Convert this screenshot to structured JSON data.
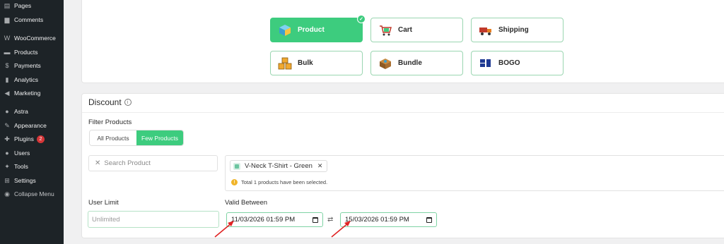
{
  "sidebar": {
    "items": [
      {
        "label": "Pages",
        "icon": "pages-icon"
      },
      {
        "label": "Comments",
        "icon": "comments-icon"
      },
      {
        "label": "WooCommerce",
        "icon": "woocommerce-icon"
      },
      {
        "label": "Products",
        "icon": "products-icon"
      },
      {
        "label": "Payments",
        "icon": "payments-icon"
      },
      {
        "label": "Analytics",
        "icon": "analytics-icon"
      },
      {
        "label": "Marketing",
        "icon": "marketing-icon"
      },
      {
        "label": "Astra",
        "icon": "astra-icon"
      },
      {
        "label": "Appearance",
        "icon": "appearance-icon"
      },
      {
        "label": "Plugins",
        "icon": "plugins-icon",
        "badge": "2"
      },
      {
        "label": "Users",
        "icon": "users-icon"
      },
      {
        "label": "Tools",
        "icon": "tools-icon"
      },
      {
        "label": "Settings",
        "icon": "settings-icon"
      },
      {
        "label": "Collapse Menu",
        "icon": "collapse-icon"
      }
    ]
  },
  "discount_types": [
    {
      "label": "Product",
      "active": true
    },
    {
      "label": "Cart",
      "active": false
    },
    {
      "label": "Shipping",
      "active": false
    },
    {
      "label": "Bulk",
      "active": false
    },
    {
      "label": "Bundle",
      "active": false
    },
    {
      "label": "BOGO",
      "active": false
    }
  ],
  "discount": {
    "title": "Discount",
    "filter_label": "Filter Products",
    "filter_options": [
      "All Products",
      "Few Products"
    ],
    "filter_selected": "Few Products",
    "search_placeholder": "Search Product",
    "selected_product": "V-Neck T-Shirt - Green",
    "selection_note": "Total 1 products have been selected.",
    "user_limit_label": "User Limit",
    "user_limit_placeholder": "Unlimited",
    "valid_between_label": "Valid Between",
    "start_date": "11/03/2026 01:59 PM",
    "end_date": "15/03/2026 01:59 PM"
  },
  "colors": {
    "accent": "#3dcc7e",
    "sidebar_bg": "#1d2327",
    "arrow": "#e02424"
  }
}
